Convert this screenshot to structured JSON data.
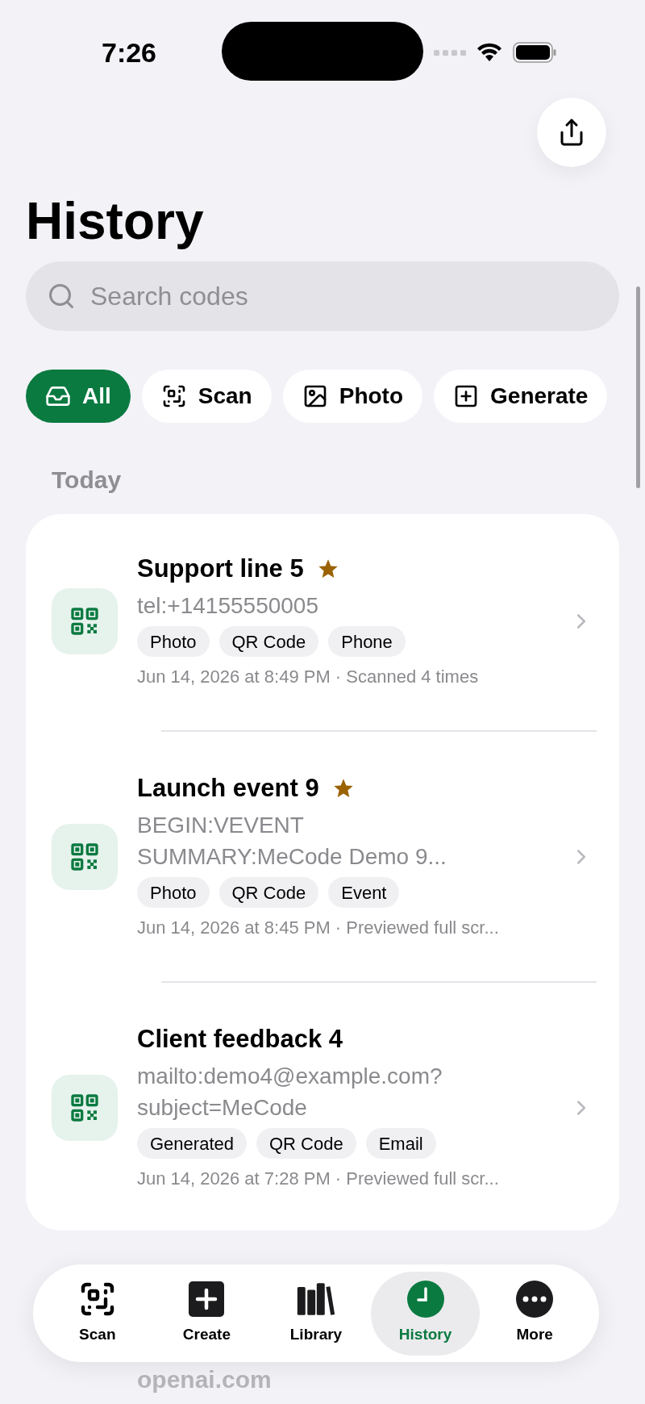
{
  "status_bar": {
    "time": "7:26"
  },
  "title": "History",
  "search": {
    "placeholder": "Search codes"
  },
  "filters": [
    {
      "label": "All",
      "kind": "all",
      "selected": true
    },
    {
      "label": "Scan",
      "kind": "scan",
      "selected": false
    },
    {
      "label": "Photo",
      "kind": "photo",
      "selected": false
    },
    {
      "label": "Generate",
      "kind": "generated",
      "selected": false
    }
  ],
  "sections": [
    {
      "title": "Today",
      "items": [
        {
          "title": "Support line 5",
          "starred": true,
          "content": [
            "tel:+14155550005"
          ],
          "tags": [
            "Photo",
            "QR Code",
            "Phone"
          ],
          "meta": "Jun 14, 2026 at 8:49 PM · Scanned 4 times"
        },
        {
          "title": "Launch event 9",
          "starred": true,
          "content": [
            "BEGIN:VEVENT",
            "SUMMARY:MeCode Demo 9..."
          ],
          "tags": [
            "Photo",
            "QR Code",
            "Event"
          ],
          "meta": "Jun 14, 2026 at 8:45 PM · Previewed full scr..."
        },
        {
          "title": "Client feedback 4",
          "starred": false,
          "content": [
            "mailto:demo4@example.com?",
            "subject=MeCode"
          ],
          "tags": [
            "Generated",
            "QR Code",
            "Email"
          ],
          "meta": "Jun 14, 2026 at 7:28 PM · Previewed full scr..."
        }
      ]
    }
  ],
  "next_row": {
    "content": "openai.com"
  },
  "tab_bar": [
    {
      "label": "Scan",
      "kind": "scan",
      "selected": false
    },
    {
      "label": "Create",
      "kind": "create",
      "selected": false
    },
    {
      "label": "Library",
      "kind": "library",
      "selected": false
    },
    {
      "label": "History",
      "kind": "history",
      "selected": true
    },
    {
      "label": "More",
      "kind": "more",
      "selected": false
    }
  ]
}
